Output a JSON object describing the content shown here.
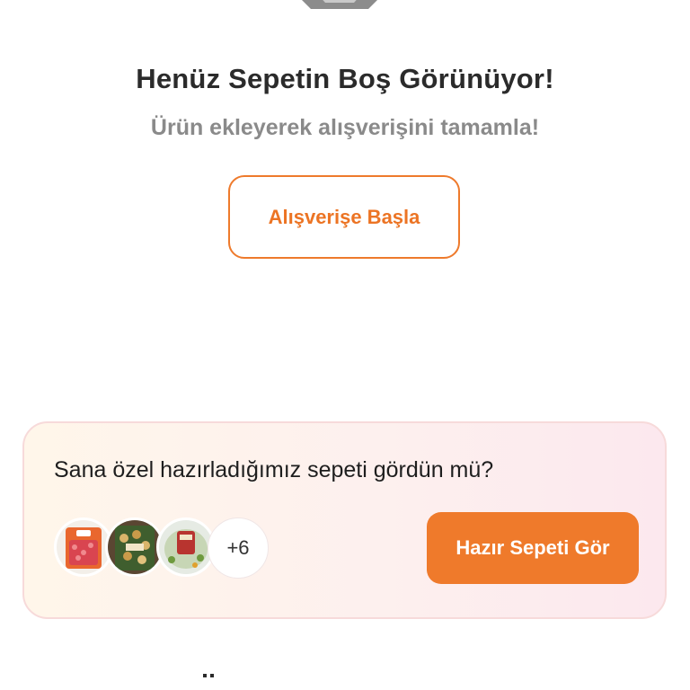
{
  "empty_cart": {
    "title": "Henüz Sepetin Boş Görünüyor!",
    "subtitle": "Ürün ekleyerek alışverişini tamamla!",
    "start_button_label": "Alışverişe Başla"
  },
  "ready_cart": {
    "title": "Sana özel hazırladığımız sepeti gördün mü?",
    "more_count": "+6",
    "button_label": "Hazır Sepeti Gör",
    "thumbnails": [
      "minced-meat-package",
      "pasta-package",
      "salad-container"
    ]
  },
  "colors": {
    "accent": "#ef7a2b",
    "title_text": "#2b2b2b",
    "subtitle_text": "#8a8a8a"
  }
}
